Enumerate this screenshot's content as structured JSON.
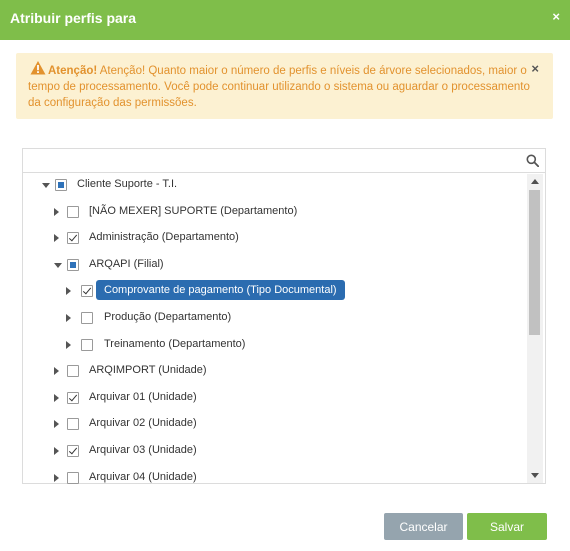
{
  "header": {
    "title": "Atribuir perfis para",
    "close_glyph": "×"
  },
  "alert": {
    "icon": "warning-icon",
    "strong": "Atenção!",
    "message": "Atenção! Quanto maior o número de perfis e níveis de árvore selecionados, maior o tempo de processamento. Você pode continuar utilizando o sistema ou aguardar o processamento da configuração das permissões.",
    "close_glyph": "×",
    "color": "#e2922e",
    "background": "#fcf1d2"
  },
  "search": {
    "value": "",
    "placeholder": "",
    "icon": "search-icon"
  },
  "tree": {
    "nodes": [
      {
        "label": "Cliente Suporte - T.I.",
        "state": "partial",
        "toggle": "expanded",
        "level": 0
      },
      {
        "label": "[NÃO MEXER] SUPORTE (Departamento)",
        "state": "unchecked",
        "toggle": "collapsed",
        "level": 1
      },
      {
        "label": "Administração (Departamento)",
        "state": "checked",
        "toggle": "collapsed",
        "level": 1
      },
      {
        "label": "ARQAPI (Filial)",
        "state": "partial",
        "toggle": "expanded",
        "level": 1
      },
      {
        "label": "Comprovante de pagamento (Tipo Documental)",
        "state": "checked",
        "toggle": "collapsed",
        "level": 2,
        "selected": true
      },
      {
        "label": "Produção (Departamento)",
        "state": "unchecked",
        "toggle": "collapsed",
        "level": 2
      },
      {
        "label": "Treinamento (Departamento)",
        "state": "unchecked",
        "toggle": "collapsed",
        "level": 2
      },
      {
        "label": "ARQIMPORT (Unidade)",
        "state": "unchecked",
        "toggle": "collapsed",
        "level": 1
      },
      {
        "label": "Arquivar 01 (Unidade)",
        "state": "checked",
        "toggle": "collapsed",
        "level": 1
      },
      {
        "label": "Arquivar 02 (Unidade)",
        "state": "unchecked",
        "toggle": "collapsed",
        "level": 1
      },
      {
        "label": "Arquivar 03 (Unidade)",
        "state": "checked",
        "toggle": "collapsed",
        "level": 1
      },
      {
        "label": "Arquivar 04 (Unidade)",
        "state": "unchecked",
        "toggle": "collapsed",
        "level": 1
      }
    ],
    "selected_color": "#2b6cb0",
    "partial_color": "#2f72b9"
  },
  "footer": {
    "cancel_label": "Cancelar",
    "save_label": "Salvar",
    "cancel_color": "#95a4ae",
    "save_color": "#7fbe4a"
  },
  "colors": {
    "brand": "#7fbe4a"
  }
}
